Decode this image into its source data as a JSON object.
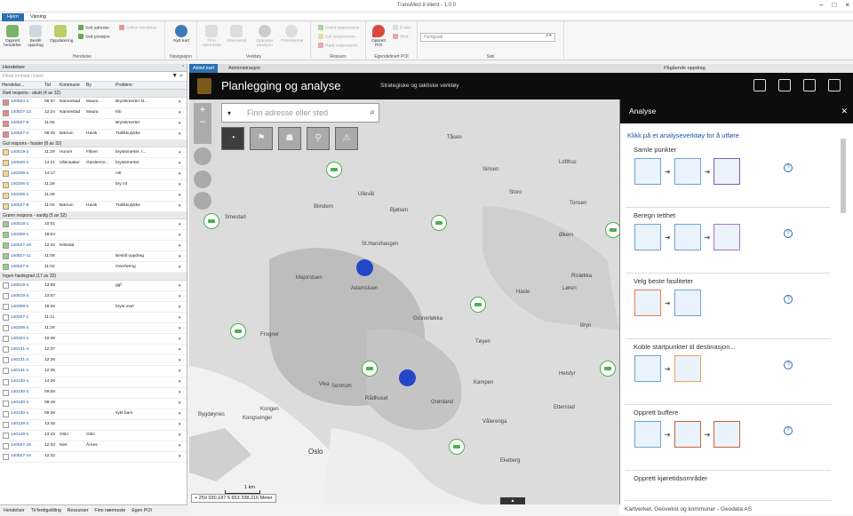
{
  "window": {
    "title": "TransMed 8 klient - 1.0.0"
  },
  "ribbon_tabs": [
    "Hjem",
    "Visning"
  ],
  "ribbon": {
    "groups": [
      {
        "label": "Hendelse",
        "big": [
          "Opprett hendelse",
          "Bestill oppdrag",
          "Oppdatering"
        ],
        "small": [
          "Sett adresse",
          "Sett posisjon",
          "Avbryt hendelse"
        ]
      },
      {
        "label": "Navigasjon",
        "big": [
          "Nytt kart"
        ]
      },
      {
        "label": "Verktøy",
        "big": [
          "Finn nærmeste",
          "Videosend",
          "Oppsøke posisjon",
          "Potentiemal"
        ]
      },
      {
        "label": "Ressurs",
        "small": [
          "Grønt responsens",
          "Gul responsens",
          "Rødt responsens"
        ]
      },
      {
        "label": "Egendefinert POI",
        "big": [
          "Opprett POI"
        ],
        "small": [
          "Endre",
          "Slett"
        ]
      },
      {
        "label": "Søk",
        "search_placeholder": "Hurtigsøk"
      }
    ]
  },
  "left_panel": {
    "title": "Hendelser",
    "filter_placeholder": "Filtrer innhold i listen",
    "columns": [
      "Hendelse...",
      "Tid",
      "Kommune",
      "By",
      "Problem"
    ],
    "groups": [
      {
        "label": "Rød respons - akutt (4 av 32)",
        "color": "#e8888a",
        "rows": [
          [
            "140524-1",
            "09:37",
            "Nannestad",
            "Maura",
            "Brystsmerter st..."
          ],
          [
            "140527-13",
            "12:24",
            "Nannestad",
            "Maura",
            "feb"
          ],
          [
            "140527-9",
            "11:05",
            "",
            "",
            "Brystsmerter"
          ],
          [
            "140527-4",
            "08:45",
            "Bærum",
            "Høvik",
            "Trafikkulykke"
          ]
        ]
      },
      {
        "label": "Gul respons - haster (8 av 32)",
        "color": "#f5d98a",
        "rows": [
          [
            "140519-2",
            "11:29",
            "Hurum",
            "Filtvet",
            "brystsmerter, t..."
          ],
          [
            "140526-2",
            "14:21",
            "Ullensaker",
            "Gardermo...",
            "brystsmerter"
          ],
          [
            "140206-4",
            "14:17",
            "",
            "",
            "nitr"
          ],
          [
            "140206-3",
            "11:26",
            "",
            "",
            "bry nit"
          ],
          [
            "140205-1",
            "11:26",
            "",
            "",
            ""
          ],
          [
            "140527-8",
            "11:02",
            "Bærum",
            "Høvik",
            "Trafikkulykke"
          ]
        ]
      },
      {
        "label": "Grønn respons - vanlig (5 av 32)",
        "color": "#9ccc8a",
        "rows": [
          [
            "140518-1",
            "10:01",
            "",
            "",
            ""
          ],
          [
            "140309-1",
            "18:04",
            "",
            "",
            ""
          ],
          [
            "140527-16",
            "12:42",
            "Nittedal",
            "",
            ""
          ],
          [
            "140527-11",
            "11:08",
            "",
            "",
            "Bestilt oppdrag"
          ],
          [
            "140527-6",
            "11:02",
            "",
            "",
            "Overføring"
          ]
        ]
      },
      {
        "label": "Ingen hastegrad (17 av 32)",
        "color": "#ffffff",
        "rows": [
          [
            "140519-4",
            "13:58",
            "",
            "",
            "ggf"
          ],
          [
            "140519-3",
            "13:57",
            "",
            "",
            ""
          ],
          [
            "140309-2",
            "18:06",
            "",
            "",
            "bryst uvel"
          ],
          [
            "140207-1",
            "11:11",
            "",
            "",
            ""
          ],
          [
            "140206-2",
            "11:26",
            "",
            "",
            ""
          ],
          [
            "140204-1",
            "10:38",
            "",
            "",
            ""
          ],
          [
            "140131-4",
            "12:37",
            "",
            "",
            ""
          ],
          [
            "140131-2",
            "12:35",
            "",
            "",
            ""
          ],
          [
            "140131-1",
            "12:35",
            "",
            "",
            ""
          ],
          [
            "140130-4",
            "14:36",
            "",
            "",
            ""
          ],
          [
            "140130-3",
            "09:59",
            "",
            "",
            ""
          ],
          [
            "140130-2",
            "09:48",
            "",
            "",
            ""
          ],
          [
            "140130-1",
            "09:36",
            "",
            "",
            "sykt barn"
          ],
          [
            "140128-2",
            "13:45",
            "",
            "",
            ""
          ],
          [
            "140128-1",
            "13:43",
            "Oslo",
            "Oslo",
            ""
          ],
          [
            "140527-15",
            "12:33",
            "Nes",
            "Årnes",
            ""
          ],
          [
            "140527-14",
            "12:32",
            "",
            "",
            ""
          ]
        ]
      }
    ],
    "footer_tabs": [
      "Hendelser",
      "Til ferdigstilling",
      "Ressurser",
      "Finn nærmeste",
      "Egen POI"
    ]
  },
  "map_tabs": [
    "Aktivt kart",
    "Administrasjon"
  ],
  "side_tab": "Pågående oppdrag",
  "map_header": {
    "title": "Planlegging og analyse",
    "subtitle": "Strategiske og taktiske verktøy"
  },
  "map": {
    "search_placeholder": "Finn adresse eller sted",
    "coordinates": "259 030,187 6 653 338,216 Meter",
    "place_labels": [
      "Bjølsen",
      "Majorstuen",
      "Frogner",
      "Grünerløkka",
      "Sinsen",
      "Tåsen",
      "Ullevål",
      "Blindern",
      "Storo",
      "Økern",
      "Helsfyr",
      "Bryn",
      "Hasle",
      "Lofthus",
      "Tonsen",
      "Oslo",
      "Sentrum",
      "Grønland",
      "Vålerenga",
      "Etterstad",
      "Kampen",
      "Tøyen",
      "Bygdøynes",
      "Kongen",
      "Ekeberg",
      "Risløkka",
      "Løren",
      "Vika",
      "Rådhuset",
      "St.Hanshaugen",
      "Smestad",
      "Kongsvinger",
      "Adamstuen"
    ],
    "scale_label": "1 km"
  },
  "analysis": {
    "title": "Analyse",
    "intro": "Klikk på et analyseverktøy for å utføre",
    "tools": [
      "Samle punkter",
      "Beregn tetthet",
      "Velg beste fasiliteter",
      "Koble startpunkter til destinasjon...",
      "Opprett buffere",
      "Opprett kjøretidsområder"
    ],
    "attribution": "Kartverket, Geovekst og kommuner - Geodata AS"
  }
}
